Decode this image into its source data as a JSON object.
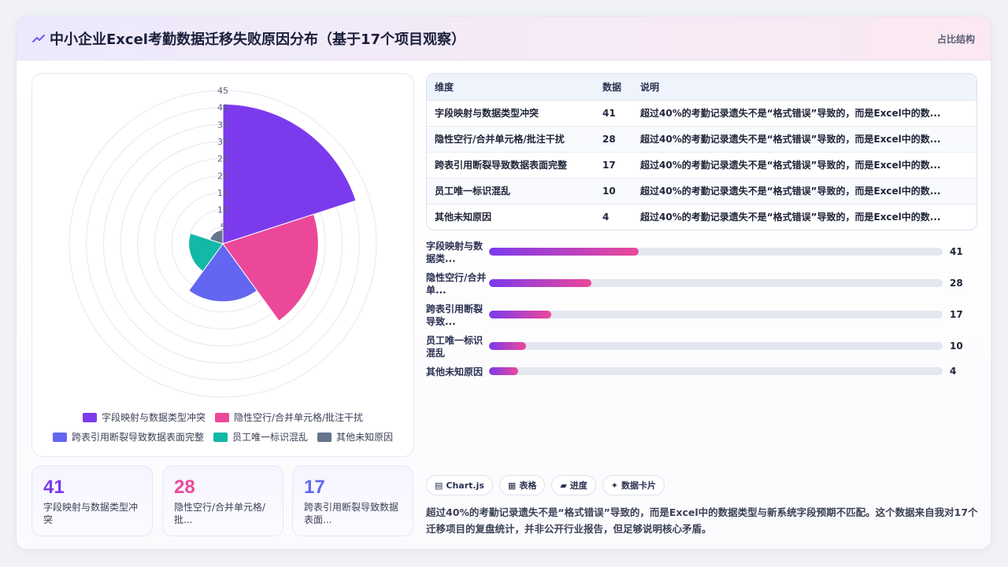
{
  "header": {
    "title": "中小企业Excel考勤数据迁移失败原因分布（基于17个项目观察）",
    "tag": "占比结构",
    "icon": "trend-icon"
  },
  "colors": {
    "c1": "#7c3aed",
    "c2": "#ec4899",
    "c3": "#6366f1",
    "c4": "#14b8a6",
    "c5": "#64748b"
  },
  "chart_data": {
    "type": "polarArea",
    "categories": [
      "字段映射与数据类型冲突",
      "隐性空行/合并单元格/批注干扰",
      "跨表引用断裂导致数据表面完整",
      "员工唯一标识混乱",
      "其他未知原因"
    ],
    "values": [
      41,
      28,
      17,
      10,
      4
    ],
    "colors": [
      "#7c3aed",
      "#ec4899",
      "#6366f1",
      "#14b8a6",
      "#64748b"
    ],
    "rlim": [
      0,
      45
    ],
    "ticks": [
      "5",
      "10",
      "15",
      "20",
      "25",
      "30",
      "35",
      "40",
      "45"
    ],
    "legend": "bottom",
    "grid": true
  },
  "legend": [
    {
      "label": "字段映射与数据类型冲突"
    },
    {
      "label": "隐性空行/合并单元格/批注干扰"
    },
    {
      "label": "跨表引用断裂导致数据表面完整"
    },
    {
      "label": "员工唯一标识混乱"
    },
    {
      "label": "其他未知原因"
    }
  ],
  "kpis": [
    {
      "value": "41",
      "label": "字段映射与数据类型冲突",
      "color": "#7c3aed"
    },
    {
      "value": "28",
      "label": "隐性空行/合并单元格/批...",
      "color": "#ec4899"
    },
    {
      "value": "17",
      "label": "跨表引用断裂导致数据表面...",
      "color": "#6366f1"
    }
  ],
  "table": {
    "headers": [
      "维度",
      "数据",
      "说明"
    ],
    "rows": [
      [
        "字段映射与数据类型冲突",
        "41",
        "超过40%的考勤记录遗失不是“格式错误”导致的，而是Excel中的数..."
      ],
      [
        "隐性空行/合并单元格/批注干扰",
        "28",
        "超过40%的考勤记录遗失不是“格式错误”导致的，而是Excel中的数..."
      ],
      [
        "跨表引用断裂导致数据表面完整",
        "17",
        "超过40%的考勤记录遗失不是“格式错误”导致的，而是Excel中的数..."
      ],
      [
        "员工唯一标识混乱",
        "10",
        "超过40%的考勤记录遗失不是“格式错误”导致的，而是Excel中的数..."
      ],
      [
        "其他未知原因",
        "4",
        "超过40%的考勤记录遗失不是“格式错误”导致的，而是Excel中的数..."
      ]
    ]
  },
  "bars": {
    "max": 41,
    "items": [
      {
        "label": "字段映射与数据类...",
        "value": "41",
        "fraction": 0.33
      },
      {
        "label": "隐性空行/合并单...",
        "value": "28",
        "fraction": 0.226
      },
      {
        "label": "跨表引用断裂导致...",
        "value": "17",
        "fraction": 0.137
      },
      {
        "label": "员工唯一标识混乱",
        "value": "10",
        "fraction": 0.081
      },
      {
        "label": "其他未知原因",
        "value": "4",
        "fraction": 0.064
      }
    ]
  },
  "chips": [
    {
      "icon": "chart-icon",
      "glyph": "▤",
      "label": "Chart.js"
    },
    {
      "icon": "table-icon",
      "glyph": "▦",
      "label": "表格"
    },
    {
      "icon": "progress-icon",
      "glyph": "▰",
      "label": "进度"
    },
    {
      "icon": "card-icon",
      "glyph": "✦",
      "label": "数据卡片"
    }
  ],
  "note": "超过40%的考勤记录遗失不是“格式错误”导致的，而是Excel中的数据类型与新系统字段预期不匹配。这个数据来自我对17个迁移项目的复盘统计，并非公开行业报告，但足够说明核心矛盾。"
}
